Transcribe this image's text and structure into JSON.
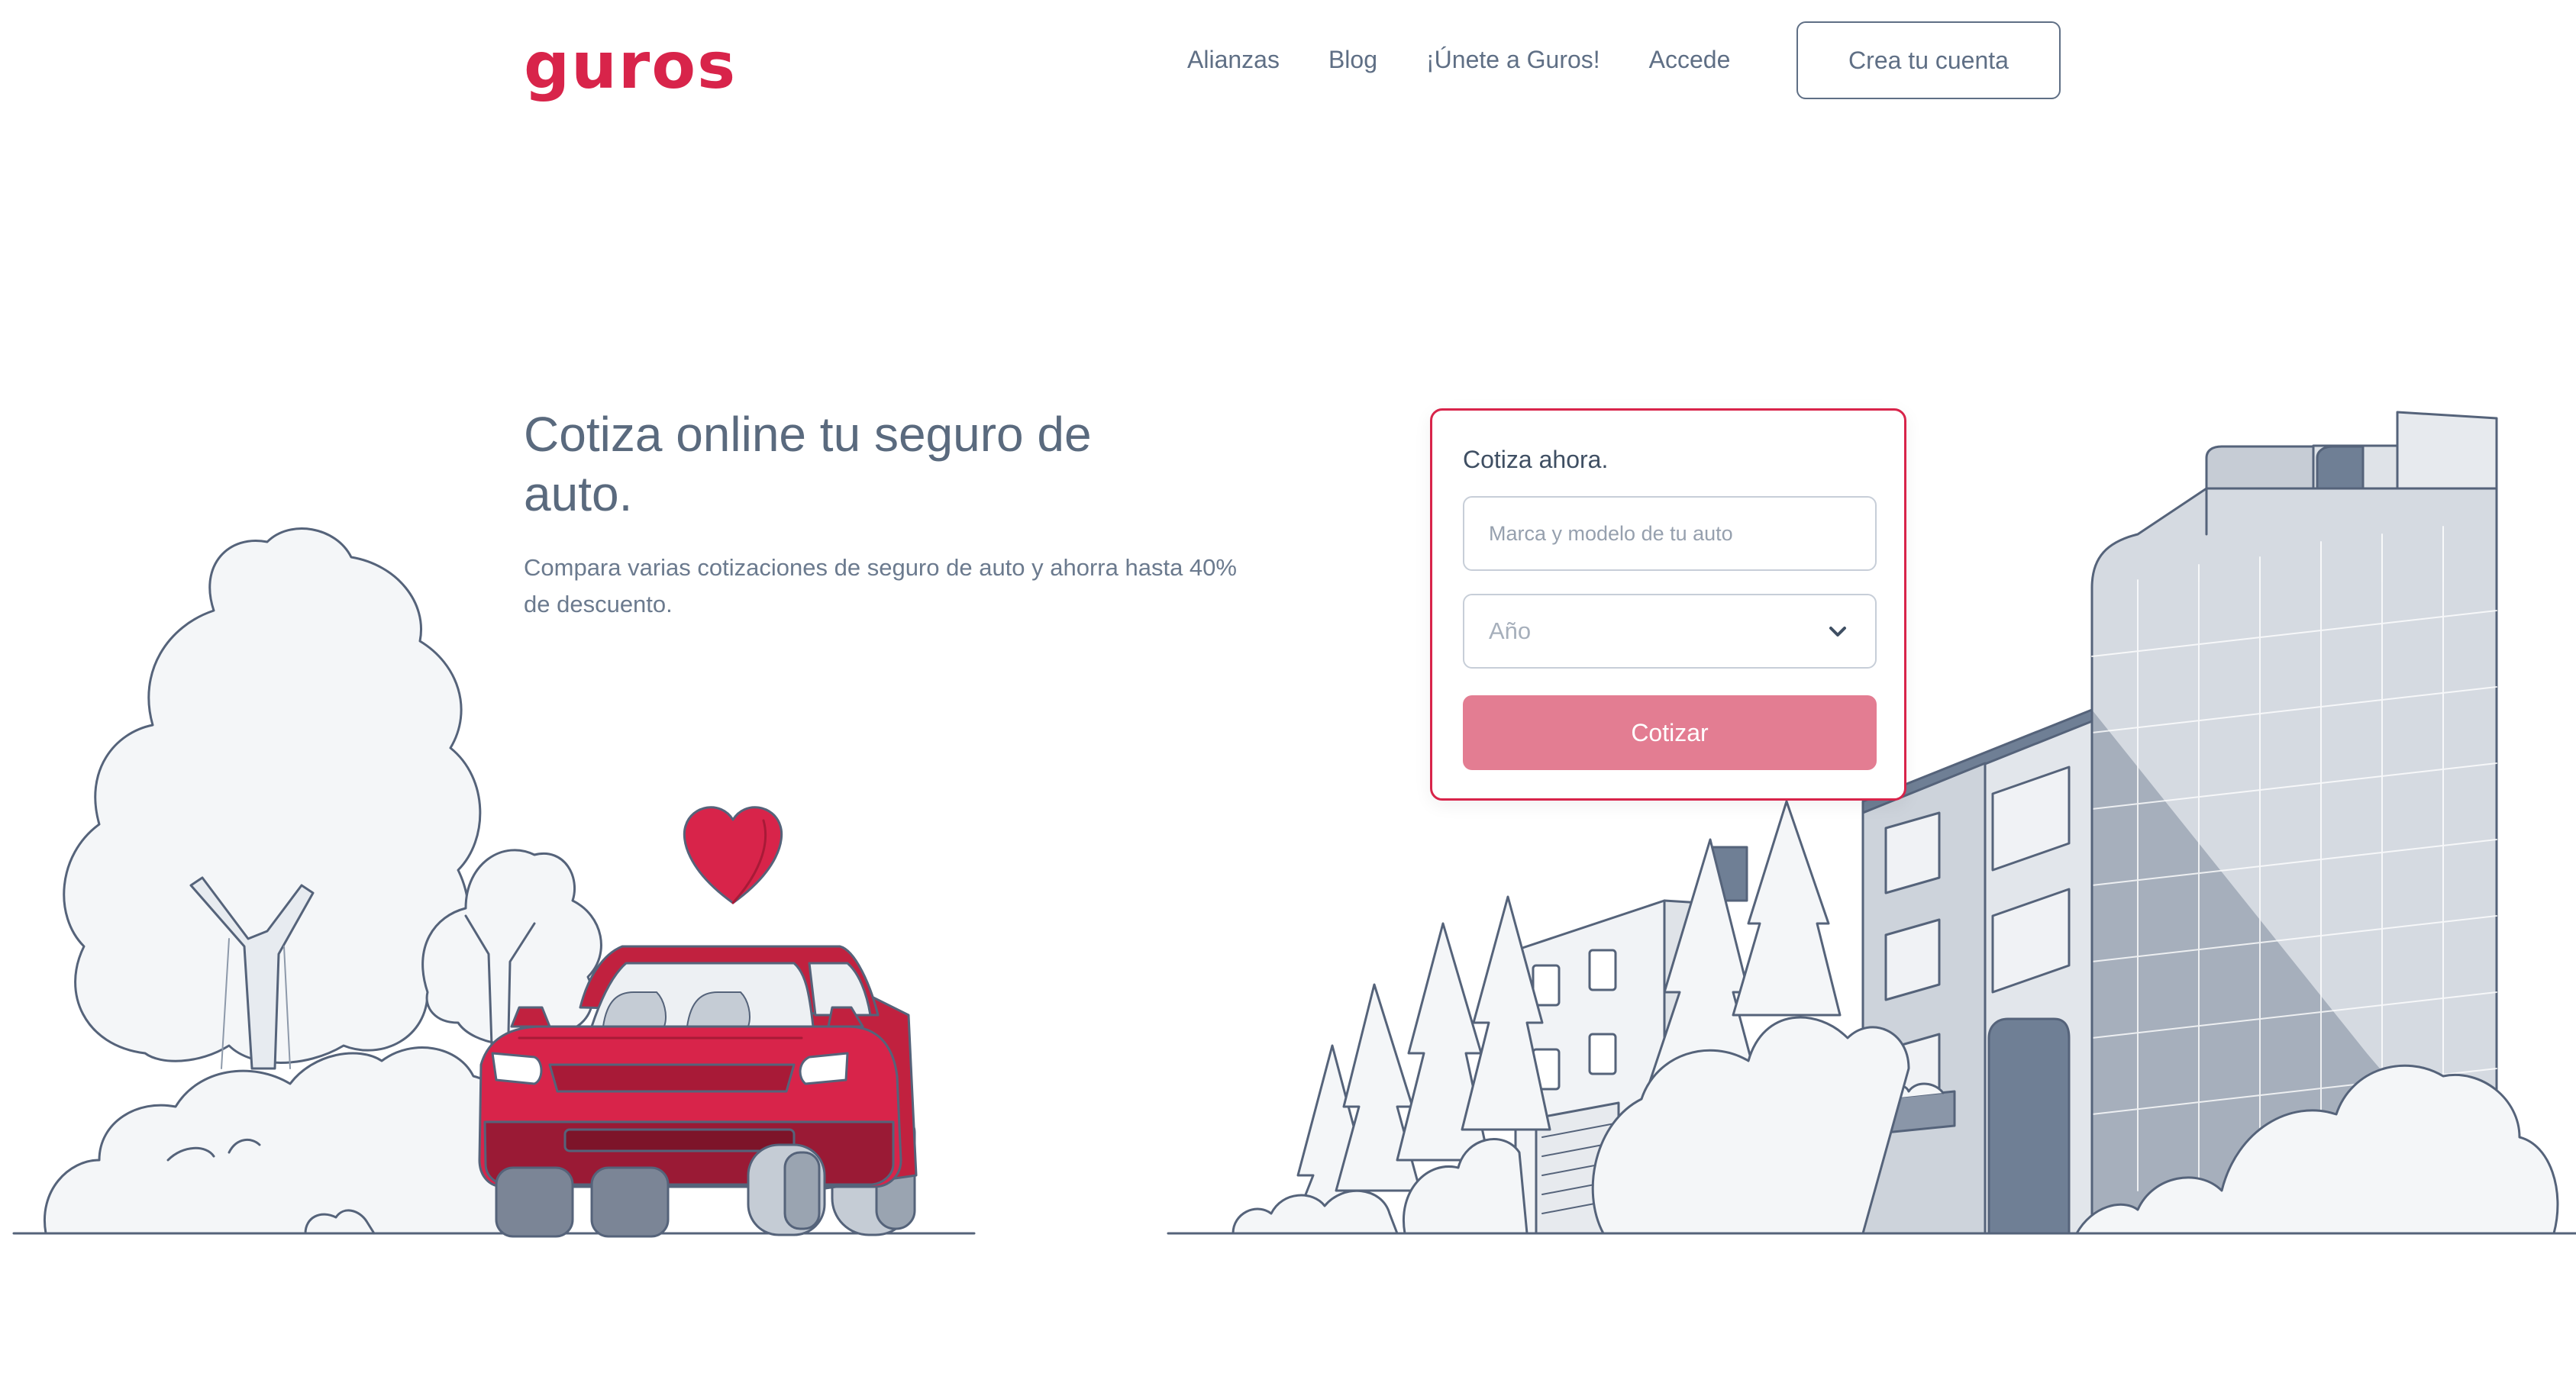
{
  "brand": {
    "logo_text": "guros",
    "color": "#d8244a"
  },
  "nav": {
    "items": [
      "Alianzas",
      "Blog",
      "¡Únete a Guros!",
      "Accede"
    ],
    "cta_label": "Crea tu cuenta"
  },
  "hero": {
    "title": "Cotiza online tu seguro de auto.",
    "subtitle": "Compara varias cotizaciones de seguro de auto y ahorra hasta 40% de descuento."
  },
  "quote_form": {
    "title": "Cotiza ahora.",
    "model_placeholder": "Marca y modelo de tu auto",
    "model_value": "",
    "year_selected": "Año",
    "submit_label": "Cotizar",
    "button_color": "#e37d92",
    "border_color": "#d8244a"
  },
  "illustration": {
    "left_scene": [
      "tree-icon",
      "bush-icon",
      "car-icon",
      "heart-icon"
    ],
    "right_scene": [
      "building-icon",
      "pine-tree-icon",
      "bush-icon"
    ]
  }
}
